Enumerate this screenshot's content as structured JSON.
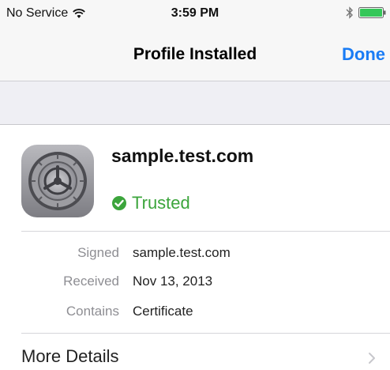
{
  "status_bar": {
    "carrier": "No Service",
    "time": "3:59 PM",
    "icons": [
      "wifi-icon",
      "bluetooth-icon",
      "battery-icon"
    ],
    "battery_color": "#35c759"
  },
  "nav": {
    "title": "Profile Installed",
    "done_label": "Done",
    "accent_color": "#1a7cf5"
  },
  "profile": {
    "name": "sample.test.com",
    "status": "Trusted",
    "status_color": "#3ca53c",
    "icon": "settings-gear-icon"
  },
  "details": [
    {
      "label": "Signed",
      "value": "sample.test.com"
    },
    {
      "label": "Received",
      "value": "Nov 13, 2013"
    },
    {
      "label": "Contains",
      "value": "Certificate"
    }
  ],
  "more": {
    "label": "More Details",
    "icon": "chevron-right-icon"
  }
}
